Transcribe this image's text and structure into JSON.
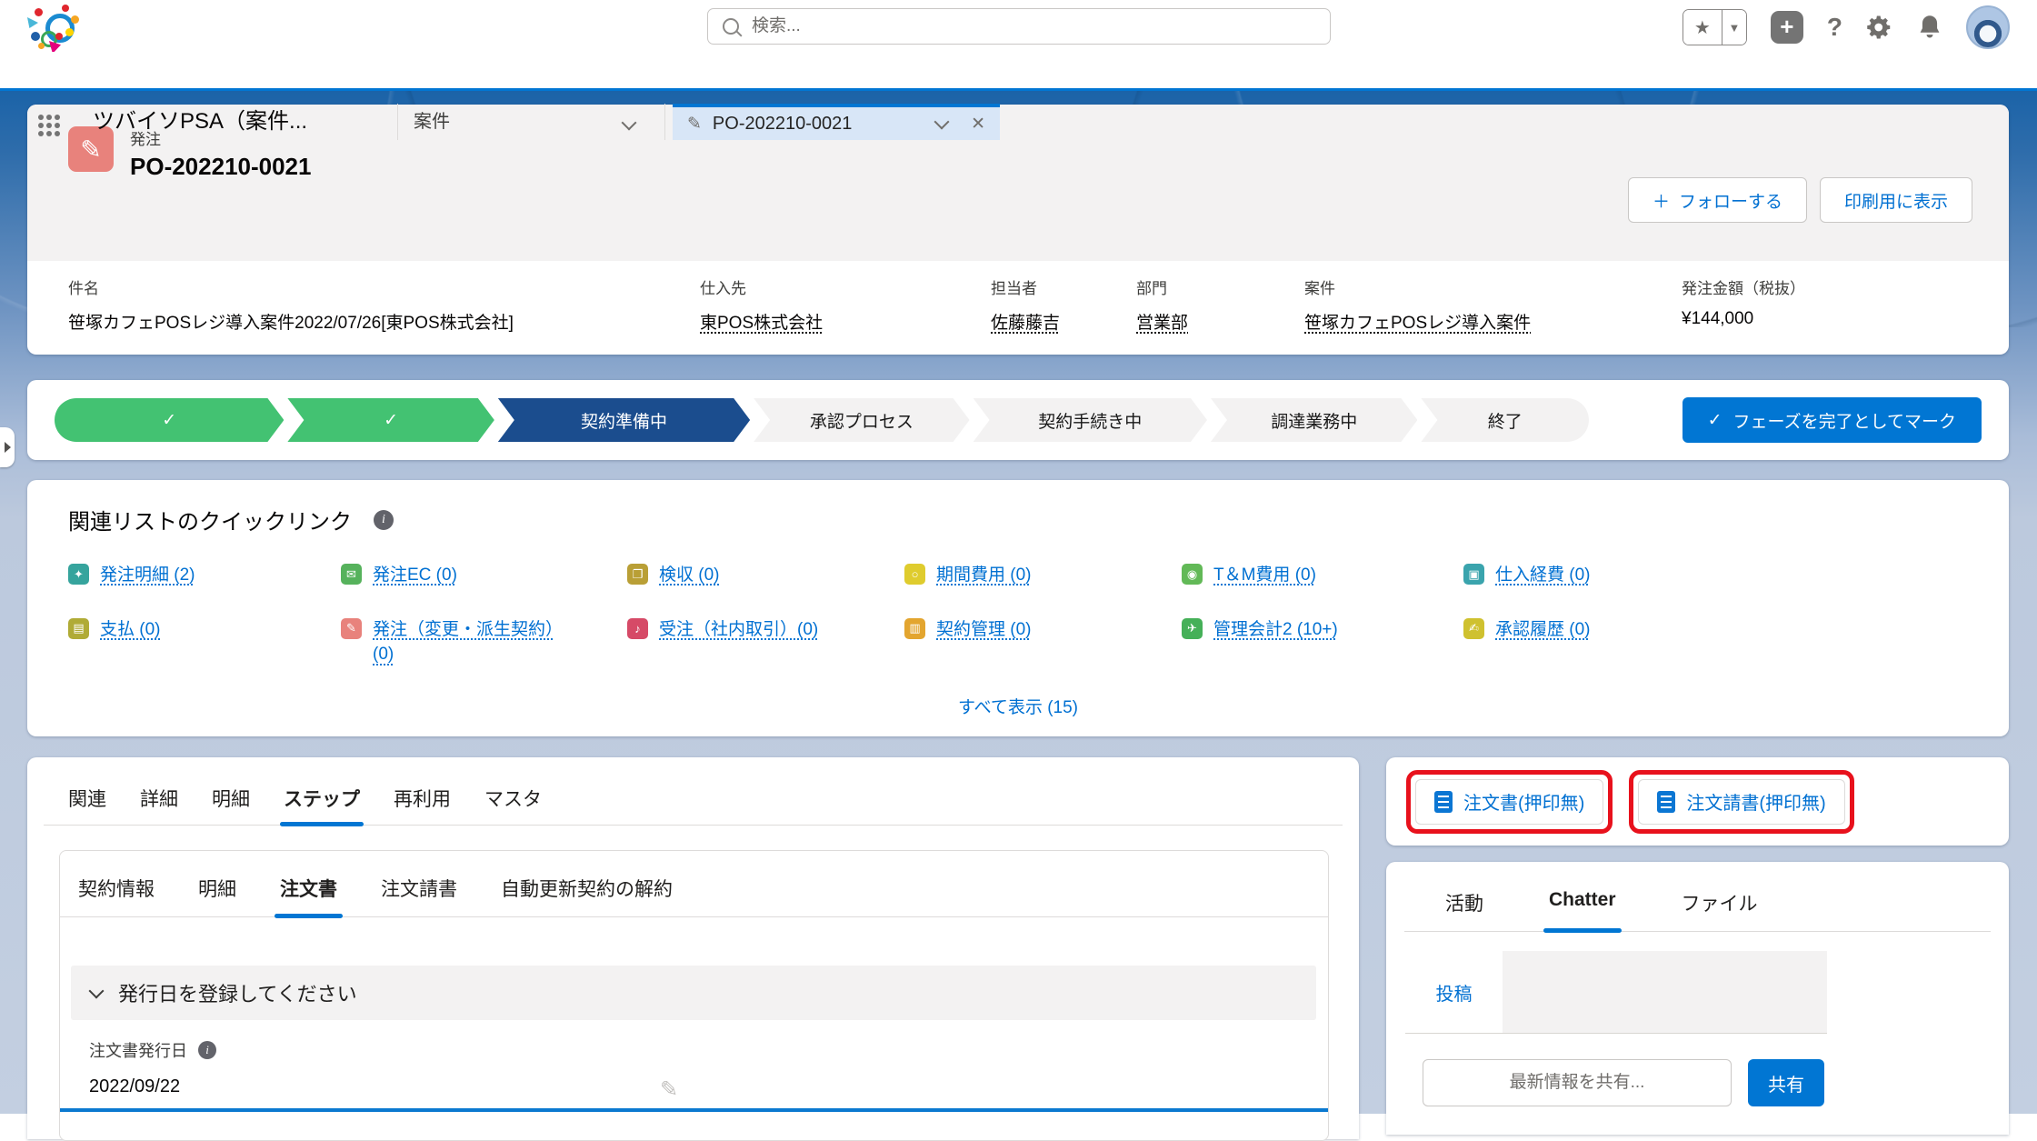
{
  "colors": {
    "brand_blue": "#0176d3",
    "link_blue": "#0070d2",
    "path_green": "#43c272",
    "path_current_navy": "#1b4d8e",
    "record_icon_salmon": "#e8827c",
    "annotation_red": "#e8111c"
  },
  "header": {
    "search_placeholder": "検索..."
  },
  "nav": {
    "app_name": "ツバイソPSA（案件...",
    "object_tab": "案件",
    "record_tab": "PO-202210-0021"
  },
  "record": {
    "entity_label": "発注",
    "record_number": "PO-202210-0021",
    "follow_plus": "＋",
    "follow_button": "フォローする",
    "print_button": "印刷用に表示",
    "fields": [
      {
        "label": "件名",
        "value": "笹塚カフェPOSレジ導入案件2022/07/26[東POS株式会社]",
        "link": false
      },
      {
        "label": "仕入先",
        "value": "東POS株式会社",
        "link": true
      },
      {
        "label": "担当者",
        "value": "佐藤藤吉",
        "link": true
      },
      {
        "label": "部門",
        "value": "営業部",
        "link": true
      },
      {
        "label": "案件",
        "value": "笹塚カフェPOSレジ導入案件",
        "link": true
      },
      {
        "label": "発注金額（税抜）",
        "value": "¥144,000",
        "link": false
      }
    ]
  },
  "path": {
    "check": "✓",
    "steps": [
      {
        "label": "",
        "state": "complete"
      },
      {
        "label": "",
        "state": "complete"
      },
      {
        "label": "契約準備中",
        "state": "current"
      },
      {
        "label": "承認プロセス",
        "state": "incomplete"
      },
      {
        "label": "契約手続き中",
        "state": "incomplete"
      },
      {
        "label": "調達業務中",
        "state": "incomplete"
      },
      {
        "label": "終了",
        "state": "incomplete"
      }
    ],
    "mark_complete_check": "✓",
    "mark_complete_button": "フェーズを完了としてマーク"
  },
  "quicklinks": {
    "title": "関連リストのクイックリンク",
    "info": "i",
    "items": [
      {
        "label": "発注明細 (2)",
        "glyph": "✦",
        "color": "#36a49d",
        "icon": "po-line-items"
      },
      {
        "label": "発注EC (0)",
        "glyph": "✉",
        "color": "#56b25c",
        "icon": "po-ec"
      },
      {
        "label": "検収 (0)",
        "glyph": "❐",
        "color": "#b99f36",
        "icon": "inspection"
      },
      {
        "label": "期間費用 (0)",
        "glyph": "○",
        "color": "#dfcc2e",
        "icon": "period-cost"
      },
      {
        "label": "T＆M費用 (0)",
        "glyph": "◉",
        "color": "#62b957",
        "icon": "tm-cost"
      },
      {
        "label": "仕入経費 (0)",
        "glyph": "▣",
        "color": "#3aa4ad",
        "icon": "purchase-expense"
      },
      {
        "label": "支払 (0)",
        "glyph": "▤",
        "color": "#b0ab36",
        "icon": "payment"
      },
      {
        "label": "発注（変更・派生契約）(0)",
        "glyph": "✎",
        "color": "#e8827c",
        "icon": "po-change"
      },
      {
        "label": "受注（社内取引）(0)",
        "glyph": "♪",
        "color": "#d64a67",
        "icon": "internal-order"
      },
      {
        "label": "契約管理 (0)",
        "glyph": "▥",
        "color": "#e3a52f",
        "icon": "contract-mgmt"
      },
      {
        "label": "管理会計2 (10+)",
        "glyph": "✈",
        "color": "#45b058",
        "icon": "mgmt-accounting"
      },
      {
        "label": "承認履歴 (0)",
        "glyph": "✍",
        "color": "#cfc12f",
        "icon": "approval-history"
      }
    ],
    "show_all": "すべて表示 (15)"
  },
  "main_panel": {
    "tabs": [
      {
        "label": "関連"
      },
      {
        "label": "詳細"
      },
      {
        "label": "明細"
      },
      {
        "label": "ステップ"
      },
      {
        "label": "再利用"
      },
      {
        "label": "マスタ"
      }
    ],
    "subtabs": [
      {
        "label": "契約情報"
      },
      {
        "label": "明細"
      },
      {
        "label": "注文書"
      },
      {
        "label": "注文請書"
      },
      {
        "label": "自動更新契約の解約"
      }
    ],
    "section_header": "発行日を登録してください",
    "issue_date_label": "注文書発行日",
    "issue_date_info": "i",
    "issue_date_value": "2022/09/22"
  },
  "side_panel": {
    "doc_buttons": [
      {
        "label": "注文書(押印無)"
      },
      {
        "label": "注文請書(押印無)"
      }
    ],
    "tabs": [
      {
        "label": "活動"
      },
      {
        "label": "Chatter"
      },
      {
        "label": "ファイル"
      }
    ],
    "post_tab": "投稿",
    "share_placeholder": "最新情報を共有...",
    "share_button": "共有"
  }
}
